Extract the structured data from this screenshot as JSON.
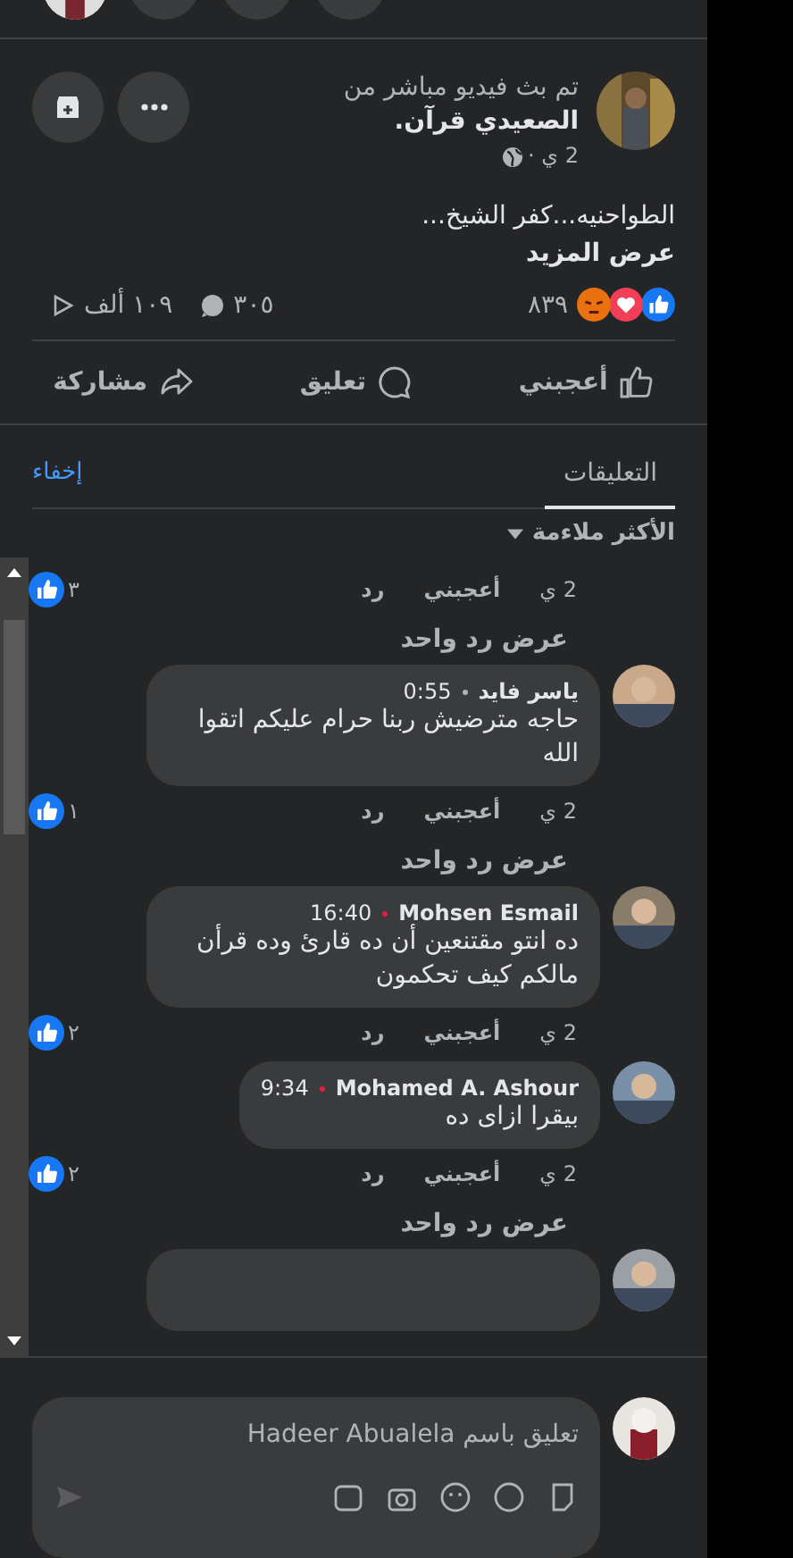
{
  "post": {
    "author_line": "تم بث فيديو مباشر من",
    "page_name": "الصعيدي قرآن.",
    "time": "2 ي ·",
    "text": "الطواحنيه...كفر الشيخ...",
    "see_more": "عرض المزيد",
    "reactions_count": "٨٣٩",
    "comments_count": "٣٠٥",
    "views_count": "١٠٩ ألف"
  },
  "actions": [
    {
      "kind": "like",
      "label": "أعجبني"
    },
    {
      "kind": "comment",
      "label": "تعليق"
    },
    {
      "kind": "share",
      "label": "مشاركة"
    }
  ],
  "comments_header": {
    "tab": "التعليقات",
    "hide": "إخفاء",
    "sort": "الأكثر ملاءمة"
  },
  "comments": [
    {
      "kind": "cut",
      "time": "2 ي",
      "like": "أعجبني",
      "reply": "رد",
      "likes": "٣",
      "replies_link": "عرض رد واحد"
    },
    {
      "kind": "full",
      "name": "ياسر فايد",
      "color": "#b0b3b8",
      "posted": "0:55",
      "text": "حاجه مترضيش ربنا حرام عليكم اتقوا الله",
      "time": "2 ي",
      "like": "أعجبني",
      "reply": "رد",
      "likes": "١",
      "replies_link": "عرض رد واحد"
    },
    {
      "kind": "full",
      "name": "Mohsen Esmail",
      "color": "#e41e3f",
      "posted": "16:40",
      "text": "ده انتو مقتنعين أن ده قارئ وده قرأن مالكم كيف تحكمون",
      "time": "2 ي",
      "like": "أعجبني",
      "reply": "رد",
      "likes": "٢"
    },
    {
      "kind": "full",
      "name": "Mohamed A. Ashour",
      "color": "#e41e3f",
      "posted": "9:34",
      "text": "بيقرا ازاى ده",
      "time": "2 ي",
      "like": "أعجبني",
      "reply": "رد",
      "likes": "٢",
      "replies_link": "عرض رد واحد"
    },
    {
      "kind": "hidden"
    }
  ],
  "composer": {
    "placeholder": "تعليق باسم Hadeer Abualela"
  }
}
